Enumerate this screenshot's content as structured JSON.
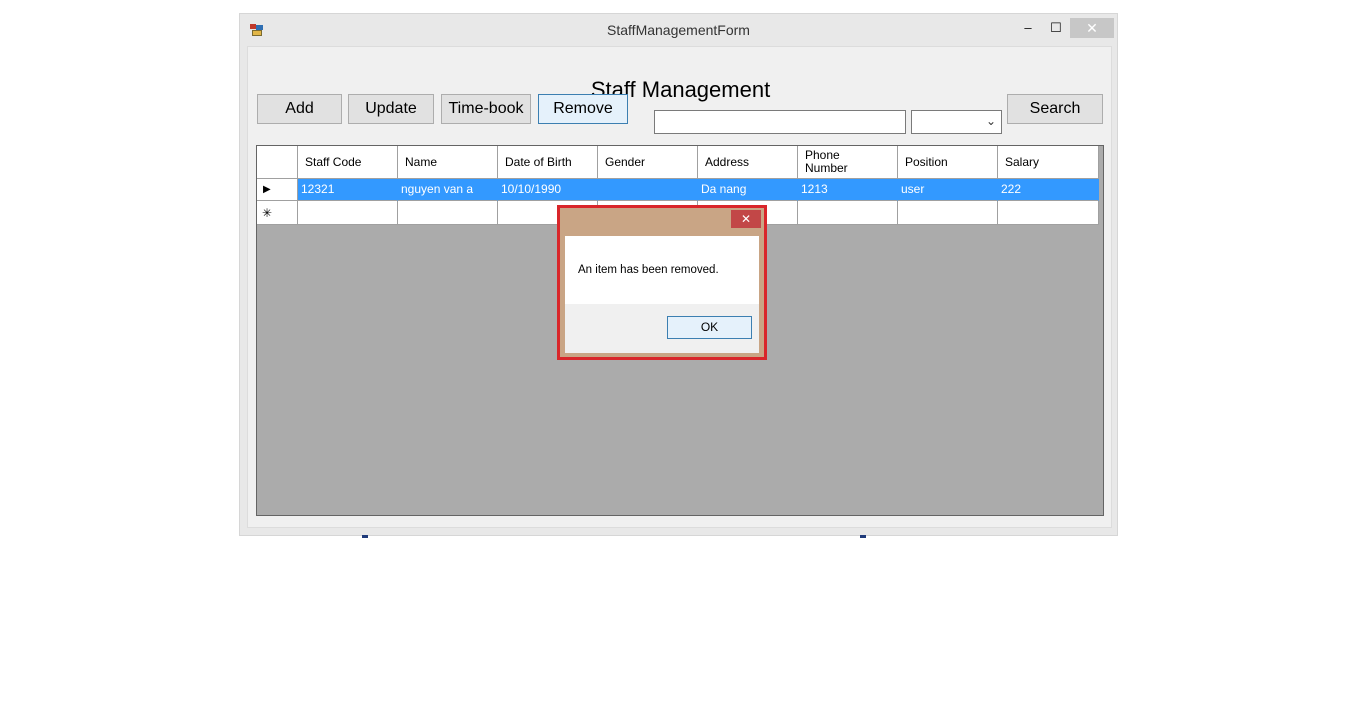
{
  "window": {
    "title": "StaffManagementForm",
    "close_glyph": "✕",
    "min_glyph": "–",
    "max_glyph": "☐"
  },
  "form": {
    "heading": "Staff Management"
  },
  "toolbar": {
    "add_label": "Add",
    "update_label": "Update",
    "timebook_label": "Time-book",
    "remove_label": "Remove",
    "search_label": "Search",
    "search_value": "",
    "filter_value": ""
  },
  "grid": {
    "columns": [
      "Staff Code",
      "Name",
      "Date of Birth",
      "Gender",
      "Address",
      "Phone Number",
      "Position",
      "Salary"
    ],
    "rows": [
      [
        "12321",
        "nguyen van a",
        "10/10/1990",
        "",
        "Da nang",
        "1213",
        "user",
        "222"
      ]
    ],
    "current_row_glyph": "▶",
    "new_row_glyph": "✳"
  },
  "dialog": {
    "message": "An item has been removed.",
    "ok_label": "OK",
    "close_glyph": "✕"
  },
  "colors": {
    "selection": "#3399ff",
    "dialog_border": "#d9262a",
    "dialog_frame": "#c9a585"
  }
}
